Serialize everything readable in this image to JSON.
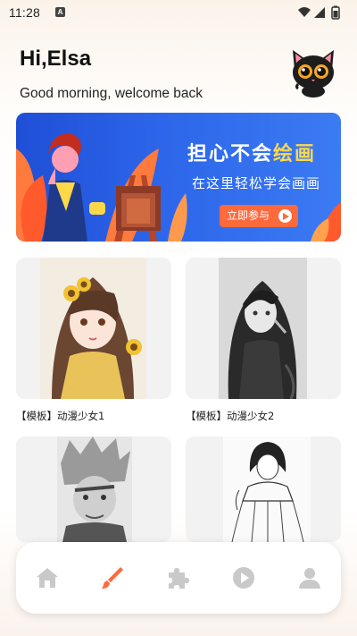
{
  "status_bar": {
    "time": "11:28",
    "notification": "A"
  },
  "header": {
    "greeting": "Hi,Elsa",
    "subtitle": "Good morning, welcome back",
    "avatar_icon": "black-cat-icon"
  },
  "banner": {
    "title_part1": "担心不会",
    "title_part2": "绘画",
    "subtitle": "在这里轻松学会画画",
    "button_label": "立即参与",
    "accent_color": "#ffd84a",
    "button_color": "#ff6a3d",
    "background_color": "#2d66ea"
  },
  "cards": [
    {
      "label": "【模板】动漫少女1",
      "image": "anime-girl-sunflower-color"
    },
    {
      "label": "【模板】动漫少女2",
      "image": "anime-girl-grayscale"
    },
    {
      "label": "",
      "image": "anime-boy-sketch"
    },
    {
      "label": "",
      "image": "anime-girl-lineart"
    }
  ],
  "nav": {
    "items": [
      {
        "name": "home",
        "icon": "home-icon",
        "active": false
      },
      {
        "name": "draw",
        "icon": "brush-icon",
        "active": true
      },
      {
        "name": "puzzle",
        "icon": "puzzle-icon",
        "active": false
      },
      {
        "name": "video",
        "icon": "play-icon",
        "active": false
      },
      {
        "name": "profile",
        "icon": "user-icon",
        "active": false
      }
    ],
    "active_color": "#ff6a3d",
    "inactive_color": "#c9c9c9"
  }
}
